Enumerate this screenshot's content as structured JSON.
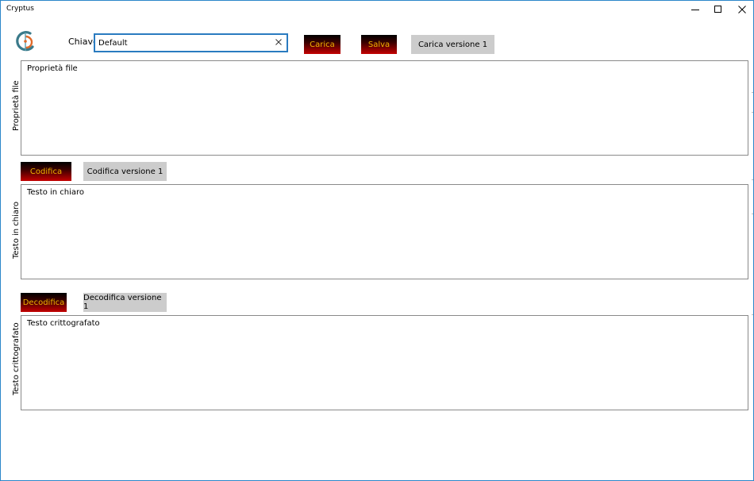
{
  "window": {
    "title": "Cryptus"
  },
  "header": {
    "key_label": "Chiave",
    "key_value": "Default",
    "load_button": "Carica",
    "save_button": "Salva",
    "load_v1_button": "Carica versione 1"
  },
  "sections": {
    "file_properties": {
      "side_label": "Proprietà file",
      "content": "Proprietà file"
    },
    "plain_text": {
      "side_label": "Testo in chiaro",
      "content": "Testo in chiaro",
      "encode_button": "Codifica",
      "encode_v1_button": "Codifica versione 1"
    },
    "cipher_text": {
      "side_label": "Testo crittografato",
      "content": "Testo crittografato",
      "decode_button": "Decodifica",
      "decode_v1_button": "Decodifica versione 1"
    }
  },
  "icons": {
    "minimize": "minimize-icon",
    "maximize": "maximize-icon",
    "close": "close-icon",
    "clear": "clear-icon",
    "logo": "app-logo-icon"
  },
  "colors": {
    "window_border": "#2b86c9",
    "input_focus_border": "#2a7bc0",
    "action_button_text": "#f0b400",
    "action_button_gradient_end": "#c40000",
    "secondary_button_bg": "#cccccc",
    "panel_border": "#8a8a8a"
  }
}
